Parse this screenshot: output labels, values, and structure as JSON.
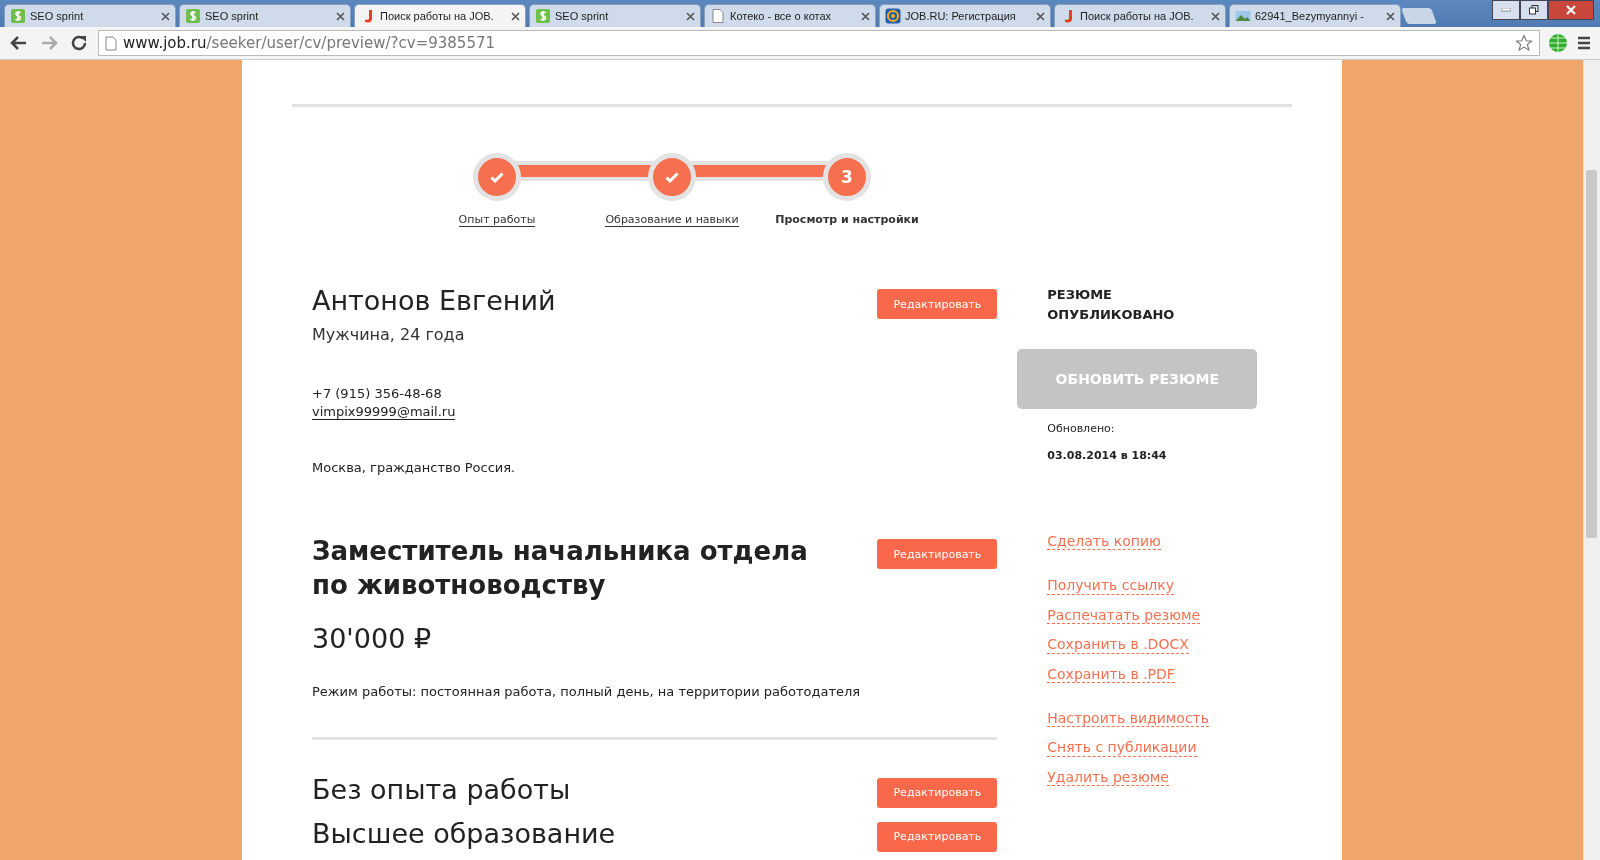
{
  "tabs": [
    {
      "kind": "seo",
      "title": "SEO sprint",
      "selected": false
    },
    {
      "kind": "seo",
      "title": "SEO sprint",
      "selected": false
    },
    {
      "kind": "job",
      "title": "Поиск работы на JOB.",
      "selected": true
    },
    {
      "kind": "seo",
      "title": "SEO sprint",
      "selected": false
    },
    {
      "kind": "doc",
      "title": "Котеко - все о котах",
      "selected": false
    },
    {
      "kind": "mail",
      "title": "JOB.RU: Регистрация",
      "selected": false
    },
    {
      "kind": "job",
      "title": "Поиск работы на JOB.",
      "selected": false
    },
    {
      "kind": "image",
      "title": "62941_Bezymyannyi -",
      "selected": false
    }
  ],
  "address": {
    "host": "www.job.ru",
    "path": "/seeker/user/cv/preview/?cv=9385571"
  },
  "steps": [
    {
      "label": "Опыт работы",
      "done": true,
      "selected": false
    },
    {
      "label": "Образование и навыки",
      "done": true,
      "selected": false
    },
    {
      "label": "Просмотр и настройки",
      "number": "3",
      "done": false,
      "selected": true
    }
  ],
  "profile": {
    "name": "Антонов Евгений",
    "info": "Мужчина, 24 года",
    "phone": "+7 (915) 356-48-68",
    "email": "vimpix99999@mail.ru",
    "location": "Москва, гражданство Россия.",
    "edit": "Редактировать"
  },
  "position": {
    "title": "Заместитель начальника отдела по животноводству",
    "salary": "30'000 ₽",
    "schedule": "Режим работы: постоянная работа, полный день, на территории работодателя",
    "edit": "Редактировать"
  },
  "sections": [
    {
      "title": "Без опыта работы",
      "edit": "Редактировать"
    },
    {
      "title": "Высшее образование",
      "edit": "Редактировать"
    }
  ],
  "sidebar": {
    "status": "РЕЗЮМЕ ОПУБЛИКОВАНО",
    "update_button": {
      "label": "ОБНОВИТЬ РЕЗЮМЕ",
      "disabled": true
    },
    "updated_label": "Обновлено:",
    "updated_at": "03.08.2014 в 18:44",
    "link_groups": [
      [
        "Сделать копию"
      ],
      [
        "Получить ссылку",
        "Распечатать резюме",
        "Сохранить в .DOCX",
        "Сохранить в .PDF"
      ],
      [
        "Настроить видимость",
        "Снять с публикации",
        "Удалить резюме"
      ]
    ]
  }
}
